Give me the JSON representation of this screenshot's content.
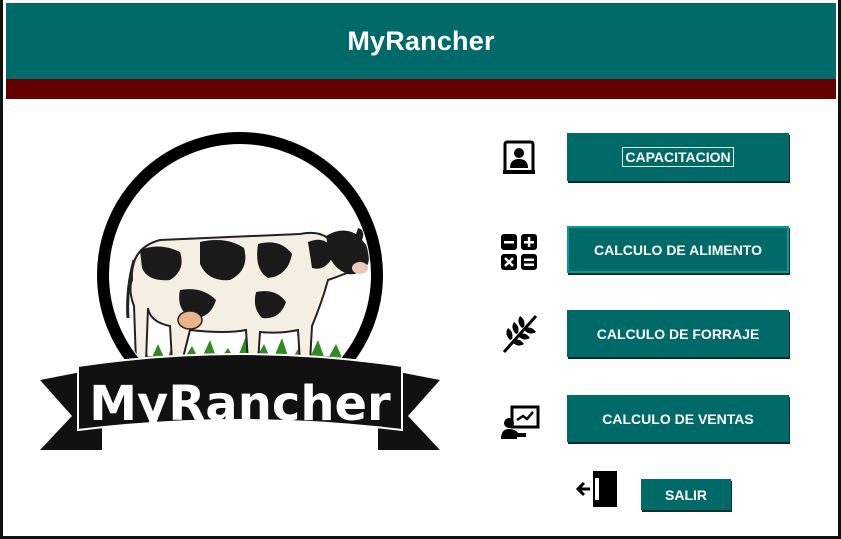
{
  "app": {
    "title": "MyRancher"
  },
  "logo": {
    "banner_text": "MyRancher"
  },
  "menu": {
    "capacitacion": {
      "label": "CAPACITACION",
      "icon": "contact-book-icon"
    },
    "alimento": {
      "label": "CALCULO DE ALIMENTO",
      "icon": "calculator-icon"
    },
    "forraje": {
      "label": "CALCULO DE FORRAJE",
      "icon": "wheat-icon"
    },
    "ventas": {
      "label": "CALCULO DE VENTAS",
      "icon": "presentation-icon"
    },
    "salir": {
      "label": "SALIR",
      "icon": "exit-door-icon"
    }
  },
  "colors": {
    "header": "#006a68",
    "accent_band": "#660000",
    "button": "#006a68",
    "button_text": "#ffffff"
  }
}
